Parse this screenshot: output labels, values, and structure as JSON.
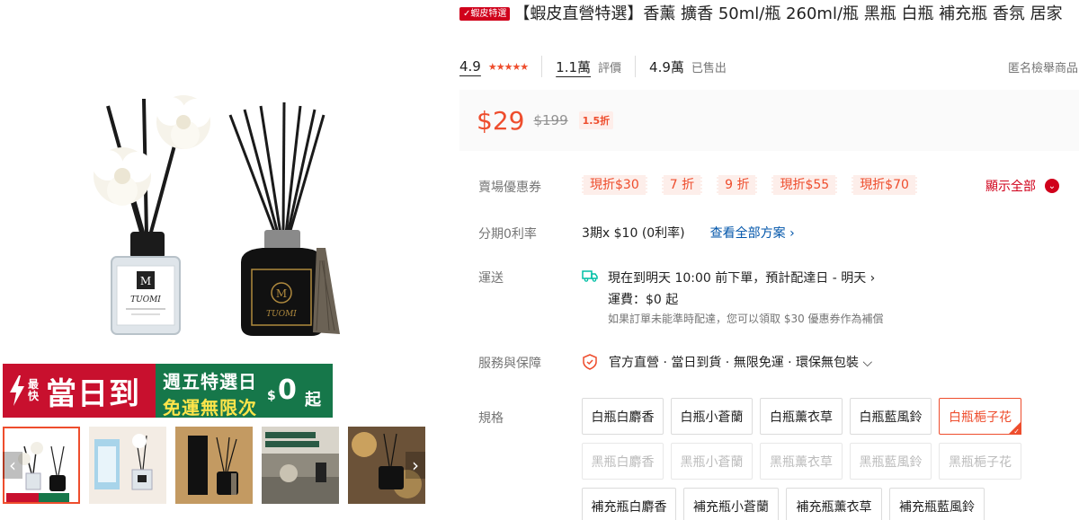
{
  "title": {
    "badge": "✓蝦皮特選",
    "text": "【蝦皮直營特選】香薰 擴香 50ml/瓶 260ml/瓶 黑瓶 白瓶 補充瓶 香氛 居家"
  },
  "stats": {
    "rating": "4.9",
    "stars": "★★★★★",
    "reviews_count": "1.1萬",
    "reviews_label": "評價",
    "sold_count": "4.9萬",
    "sold_label": "已售出",
    "report": "匿名檢舉商品"
  },
  "price": {
    "current": "$29",
    "original": "$199",
    "discount": "1.5折"
  },
  "coupons": {
    "label": "賣場優惠券",
    "items": [
      "現折$30",
      "7 折",
      "9 折",
      "現折$55",
      "現折$70"
    ],
    "show_all": "顯示全部"
  },
  "installment": {
    "label": "分期0利率",
    "text": "3期x $10 (0利率)",
    "link": "查看全部方案 ›"
  },
  "shipping": {
    "label": "運送",
    "line1": "現在到明天 10:00 前下單，預計配達日 - 明天 ›",
    "line2": "運費：$0 起",
    "line3": "如果訂單未能準時配達，您可以領取 $30 優惠券作為補償"
  },
  "service": {
    "label": "服務與保障",
    "text": "官方直營 · 當日到貨 · 無限免運 · 環保無包裝 ⌵"
  },
  "variants": {
    "label": "規格",
    "row1": [
      "白瓶白麝香",
      "白瓶小蒼蘭",
      "白瓶薰衣草",
      "白瓶藍風鈴",
      "白瓶梔子花"
    ],
    "row2": [
      "黑瓶白麝香",
      "黑瓶小蒼蘭",
      "黑瓶薰衣草",
      "黑瓶藍風鈴",
      "黑瓶梔子花"
    ],
    "row3": [
      "補充瓶白麝香",
      "補充瓶小蒼蘭",
      "補充瓶薰衣草",
      "補充瓶藍風鈴"
    ],
    "selected": "白瓶梔子花"
  },
  "banner": {
    "small": "最快",
    "big": "當日到",
    "line1": "週五特選日",
    "line2": "免運無限次",
    "dollar": "$",
    "zero": "0",
    "qi": "起"
  },
  "product_labels": {
    "brand": "TUOMI",
    "monogram": "M"
  },
  "colors": {
    "accent": "#ee4d2d",
    "brand_red": "#d0011b",
    "banner_red": "#c8102e",
    "banner_green": "#16774a"
  }
}
